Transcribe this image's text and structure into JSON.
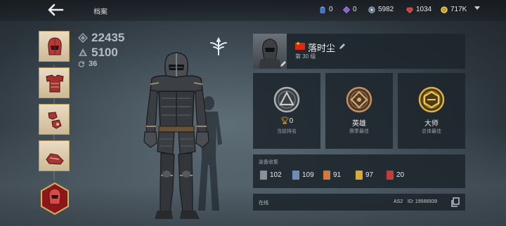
{
  "header": {
    "title": "档案",
    "resources": [
      {
        "name": "energy",
        "icon": "battery-icon",
        "value": "0",
        "color": "#3a6fd8"
      },
      {
        "name": "gems",
        "icon": "gem-icon",
        "value": "0",
        "color": "#8a5ad8"
      },
      {
        "name": "eternal-orbs",
        "icon": "orb-icon",
        "value": "5982",
        "color": "#9fb6c8"
      },
      {
        "name": "rubies",
        "icon": "ruby-icon",
        "value": "1034",
        "color": "#d83a3a"
      },
      {
        "name": "gold",
        "icon": "coin-icon",
        "value": "717K",
        "color": "#e8b830"
      }
    ]
  },
  "stats": {
    "power": "22435",
    "armor": "5100",
    "level": "36"
  },
  "profile": {
    "name": "落时尘",
    "level_text": "第 30 级"
  },
  "ranks": [
    {
      "value": "0",
      "label": "当前排名",
      "emblem": "silver-rank-emblem",
      "color": "#aeb2b5"
    },
    {
      "value": "英雄",
      "label": "赛季最佳",
      "emblem": "bronze-rank-emblem",
      "color": "#c89060"
    },
    {
      "value": "大师",
      "label": "总体最佳",
      "emblem": "gold-rank-emblem",
      "color": "#e0b040"
    }
  ],
  "collection": {
    "title": "装备收集",
    "items": [
      {
        "value": "102",
        "color": "#8c9196"
      },
      {
        "value": "109",
        "color": "#6e8fb3"
      },
      {
        "value": "91",
        "color": "#d27a3c"
      },
      {
        "value": "97",
        "color": "#d9a93a"
      },
      {
        "value": "20",
        "color": "#c33b3b"
      }
    ]
  },
  "footer": {
    "status": "在线",
    "server": "AS2",
    "id_text": "ID: 19566939"
  }
}
